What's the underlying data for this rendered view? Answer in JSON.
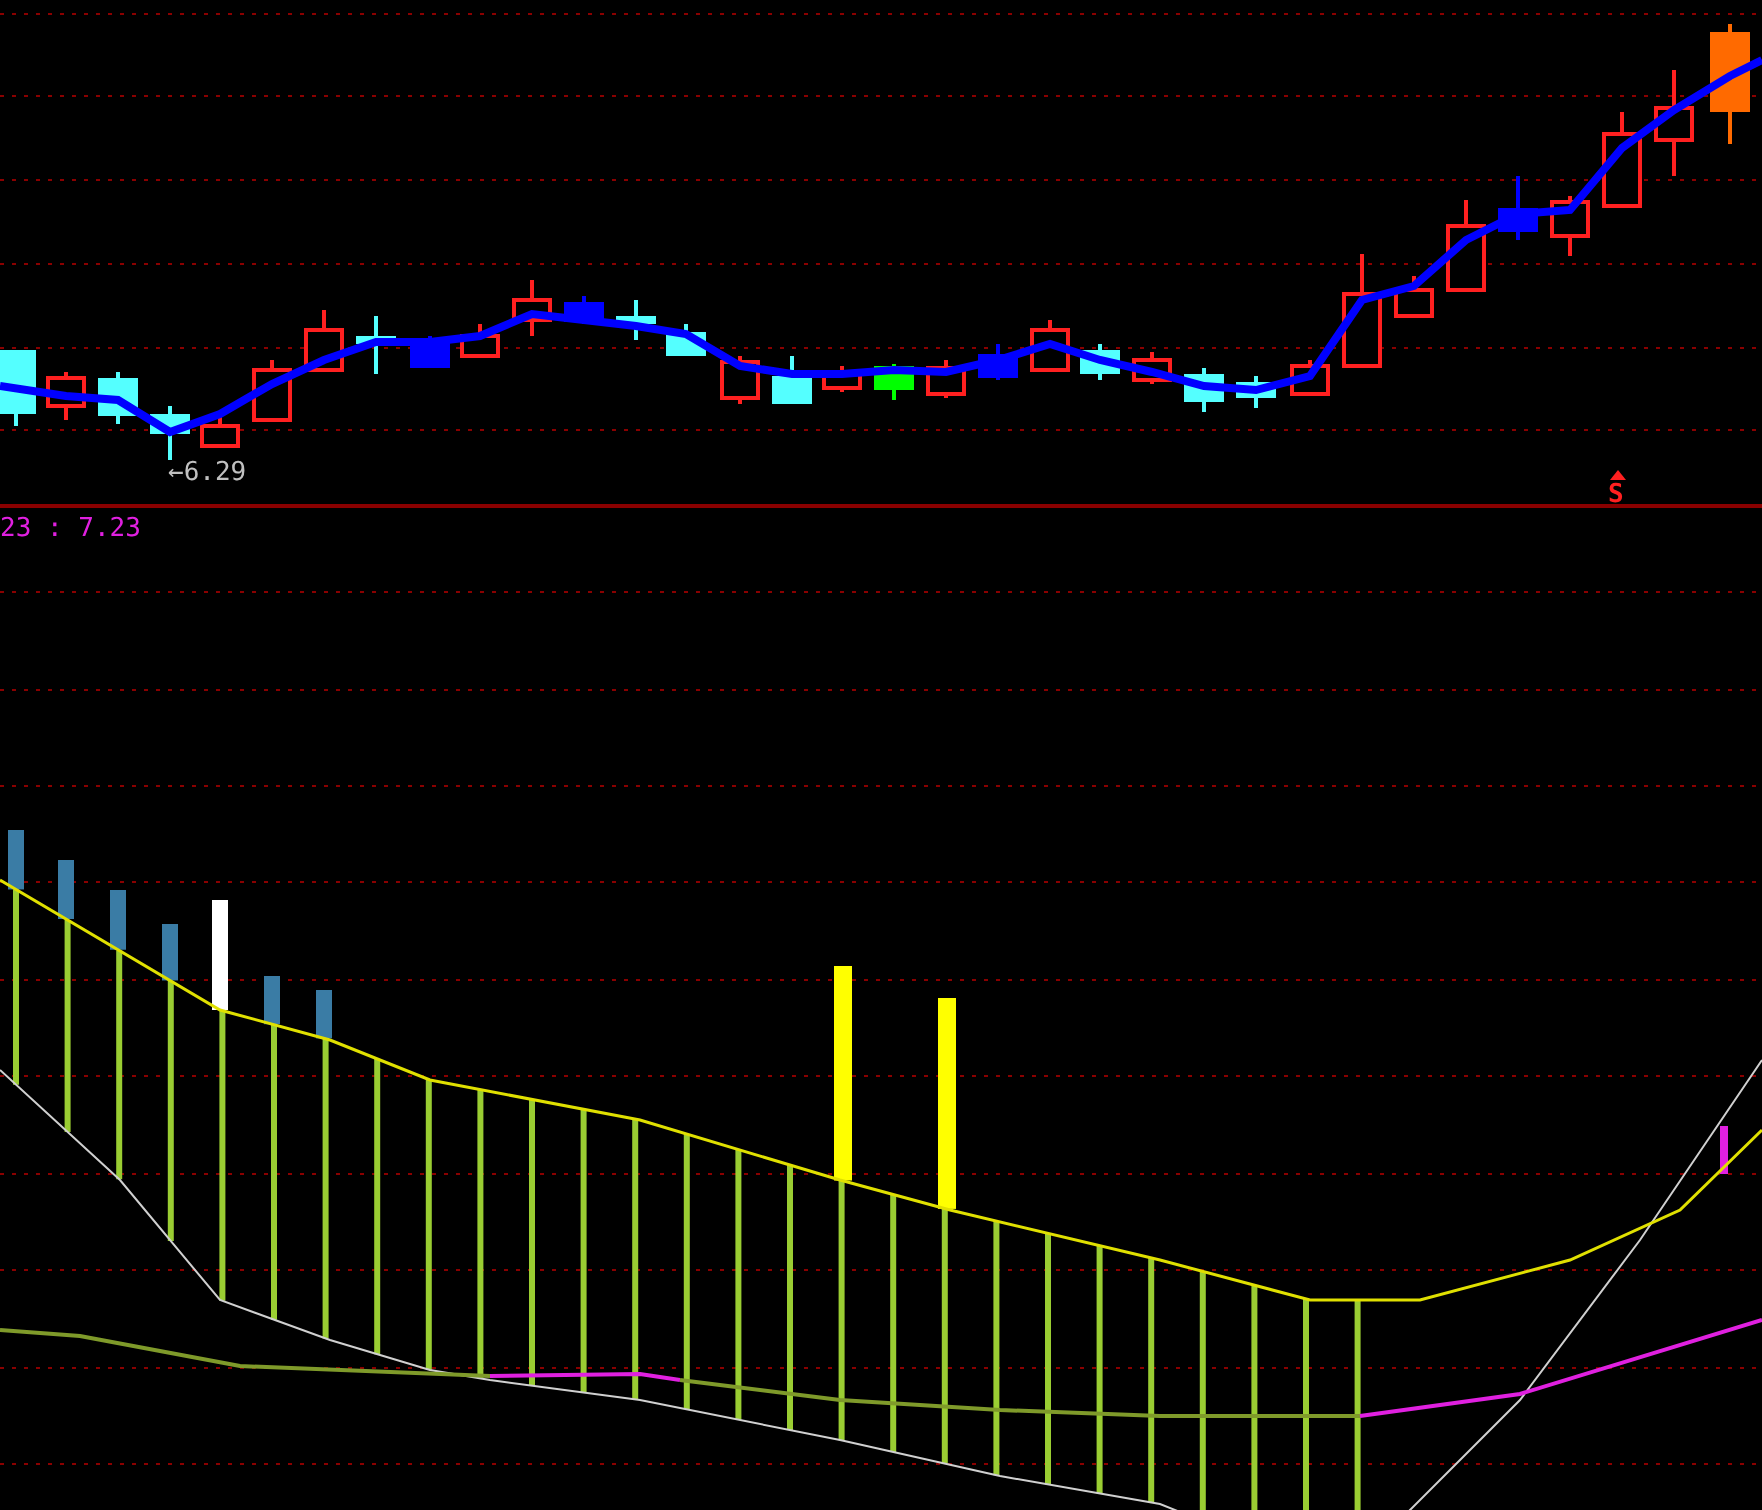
{
  "price_panel": {
    "low_marker": "←6.29",
    "signal": "S"
  },
  "indicator_panel": {
    "label": "23 : 7.23"
  }
}
